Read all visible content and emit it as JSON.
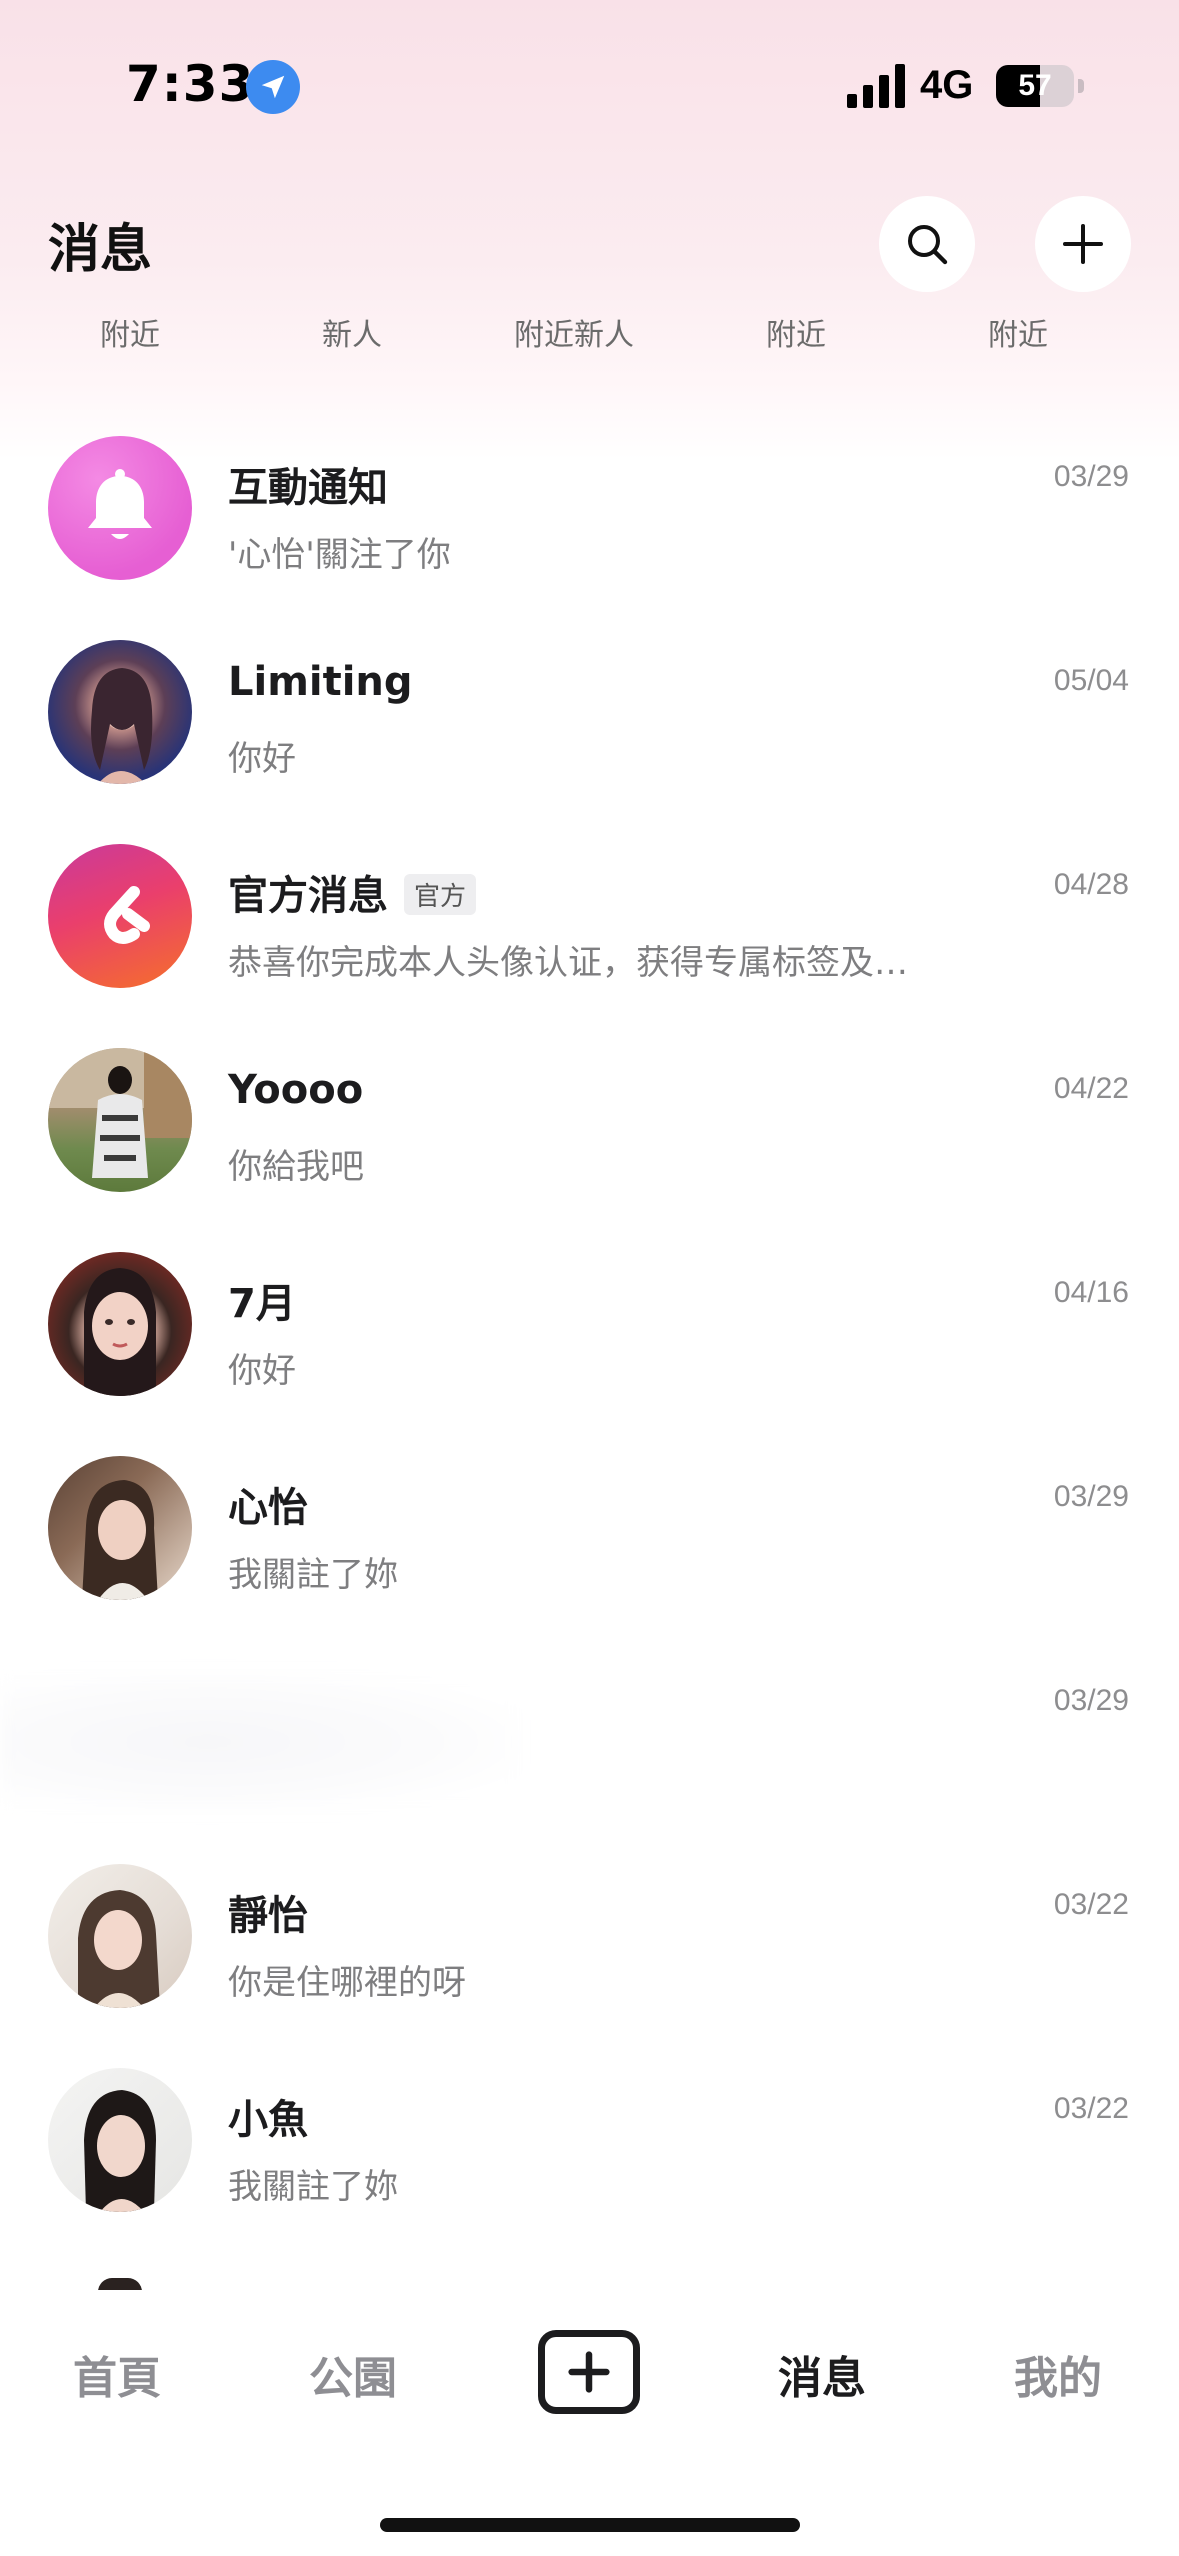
{
  "status_bar": {
    "time": "7:33",
    "network": "4G",
    "battery_percent": 57,
    "battery_label": "57"
  },
  "header": {
    "title": "消息",
    "search_icon": "search-icon",
    "add_icon": "plus-icon"
  },
  "quick_tabs": [
    "附近",
    "新人",
    "附近新人",
    "附近",
    "附近"
  ],
  "conversations": [
    {
      "name": "互動通知",
      "message": "'心怡'關注了你",
      "date": "03/29",
      "avatar": "bell-icon"
    },
    {
      "name": "Limiting",
      "message": "你好",
      "date": "05/04",
      "avatar": "user-photo"
    },
    {
      "name": "官方消息",
      "badge": "官方",
      "message": "恭喜你完成本人头像认证，获得专属标签及…",
      "date": "04/28",
      "avatar": "app-logo-icon"
    },
    {
      "name": "Yoooo",
      "message": "你給我吧",
      "date": "04/22",
      "avatar": "user-photo"
    },
    {
      "name": "7月",
      "message": "你好",
      "date": "04/16",
      "avatar": "user-photo"
    },
    {
      "name": "心怡",
      "message": "我關註了妳",
      "date": "03/29",
      "avatar": "user-photo"
    },
    {
      "name": "",
      "message": "",
      "date": "03/29",
      "avatar": "blurred"
    },
    {
      "name": "靜怡",
      "message": "你是住哪裡的呀",
      "date": "03/22",
      "avatar": "user-photo"
    },
    {
      "name": "小魚",
      "message": "我關註了妳",
      "date": "03/22",
      "avatar": "user-photo"
    }
  ],
  "tab_bar": {
    "items": [
      "首頁",
      "公園",
      "消息",
      "我的"
    ],
    "active": "消息",
    "create_icon": "plus-square-icon"
  },
  "colors": {
    "header_gradient_top": "#f9e1e8",
    "notification_avatar": "#ec6ad8",
    "official_avatar_top": "#d63d8f",
    "official_avatar_bottom": "#f4632e",
    "location_blue": "#3d8bf0",
    "muted_text": "#7e7e80"
  }
}
